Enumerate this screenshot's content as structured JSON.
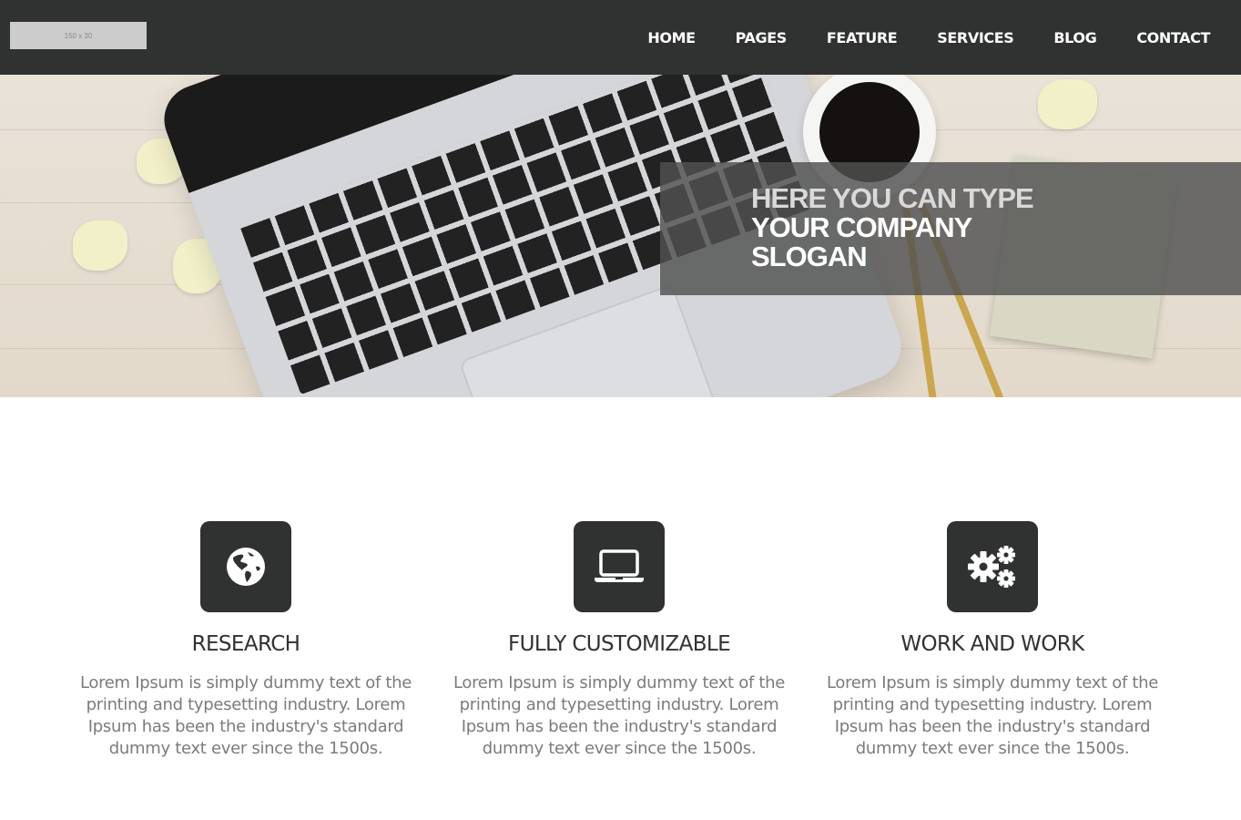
{
  "header": {
    "logo_text": "150 x 30",
    "nav": [
      {
        "label": "HOME"
      },
      {
        "label": "PAGES"
      },
      {
        "label": "FEATURE"
      },
      {
        "label": "SERVICES"
      },
      {
        "label": "BLOG"
      },
      {
        "label": "CONTACT"
      }
    ]
  },
  "hero": {
    "slogan_line1": "HERE YOU CAN TYPE",
    "slogan_line2": "YOUR COMPANY",
    "slogan_line3": "SLOGAN"
  },
  "features": [
    {
      "icon": "globe-icon",
      "title": "RESEARCH",
      "text": "Lorem Ipsum is simply dummy text of the printing and typesetting industry. Lorem Ipsum has been the industry's standard dummy text ever since the 1500s."
    },
    {
      "icon": "laptop-icon",
      "title": "FULLY CUSTOMIZABLE",
      "text": "Lorem Ipsum is simply dummy text of the printing and typesetting industry. Lorem Ipsum has been the industry's standard dummy text ever since the 1500s."
    },
    {
      "icon": "gears-icon",
      "title": "WORK AND WORK",
      "text": "Lorem Ipsum is simply dummy text of the printing and typesetting industry. Lorem Ipsum has been the industry's standard dummy text ever since the 1500s."
    }
  ],
  "colors": {
    "header_bg": "#303131",
    "icon_box_bg": "#303131",
    "body_text": "#7b7b7b"
  }
}
